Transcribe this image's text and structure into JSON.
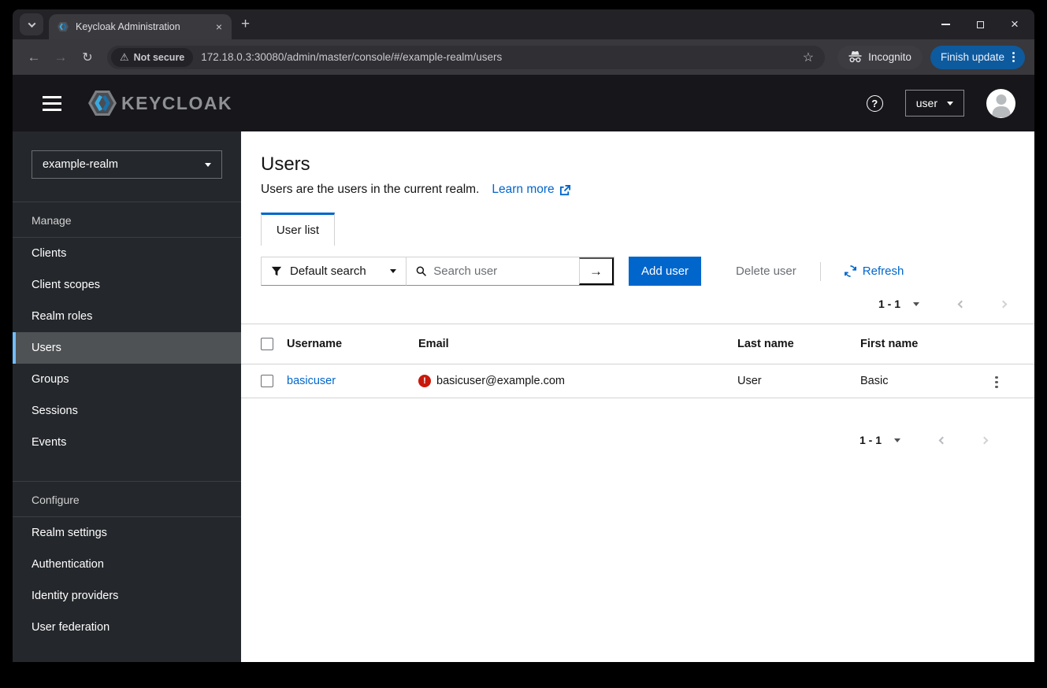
{
  "browser": {
    "tab_title": "Keycloak Administration",
    "security_chip": "Not secure",
    "url": "172.18.0.3:30080/admin/master/console/#/example-realm/users",
    "incognito_label": "Incognito",
    "update_button": "Finish update"
  },
  "icons": {
    "back_arrow": "←",
    "forward_arrow": "→",
    "reload": "↻",
    "warning": "⚠",
    "star": "☆",
    "tab_close": "×",
    "new_tab": "+",
    "window_close": "×",
    "help": "?",
    "search_submit": "→",
    "error_exclamation": "!"
  },
  "masthead": {
    "brand": "KEYCLOAK",
    "user_menu_label": "user"
  },
  "sidebar": {
    "realm_selector": "example-realm",
    "sections": [
      {
        "label": "Manage",
        "items": [
          "Clients",
          "Client scopes",
          "Realm roles",
          "Users",
          "Groups",
          "Sessions",
          "Events"
        ],
        "active_item": "Users"
      },
      {
        "label": "Configure",
        "items": [
          "Realm settings",
          "Authentication",
          "Identity providers",
          "User federation"
        ]
      }
    ]
  },
  "main": {
    "title": "Users",
    "subtitle": "Users are the users in the current realm.",
    "learn_more_label": "Learn more",
    "tabs": [
      {
        "label": "User list",
        "active": true
      }
    ],
    "toolbar": {
      "filter_dropdown_value": "Default search",
      "search_placeholder": "Search user",
      "add_user_label": "Add user",
      "delete_user_label": "Delete user",
      "refresh_label": "Refresh"
    },
    "pagination": {
      "range": "1 - 1"
    },
    "table": {
      "columns": [
        "Username",
        "Email",
        "Last name",
        "First name"
      ],
      "rows": [
        {
          "username": "basicuser",
          "email": "basicuser@example.com",
          "email_unverified": true,
          "last_name": "User",
          "first_name": "Basic"
        }
      ]
    }
  },
  "colors": {
    "accent_link": "#0066cc",
    "primary_button": "#0066cc",
    "nav_active_accent": "#73bcf7",
    "error": "#c9190b",
    "chrome_update_button": "#0e5a9e"
  }
}
